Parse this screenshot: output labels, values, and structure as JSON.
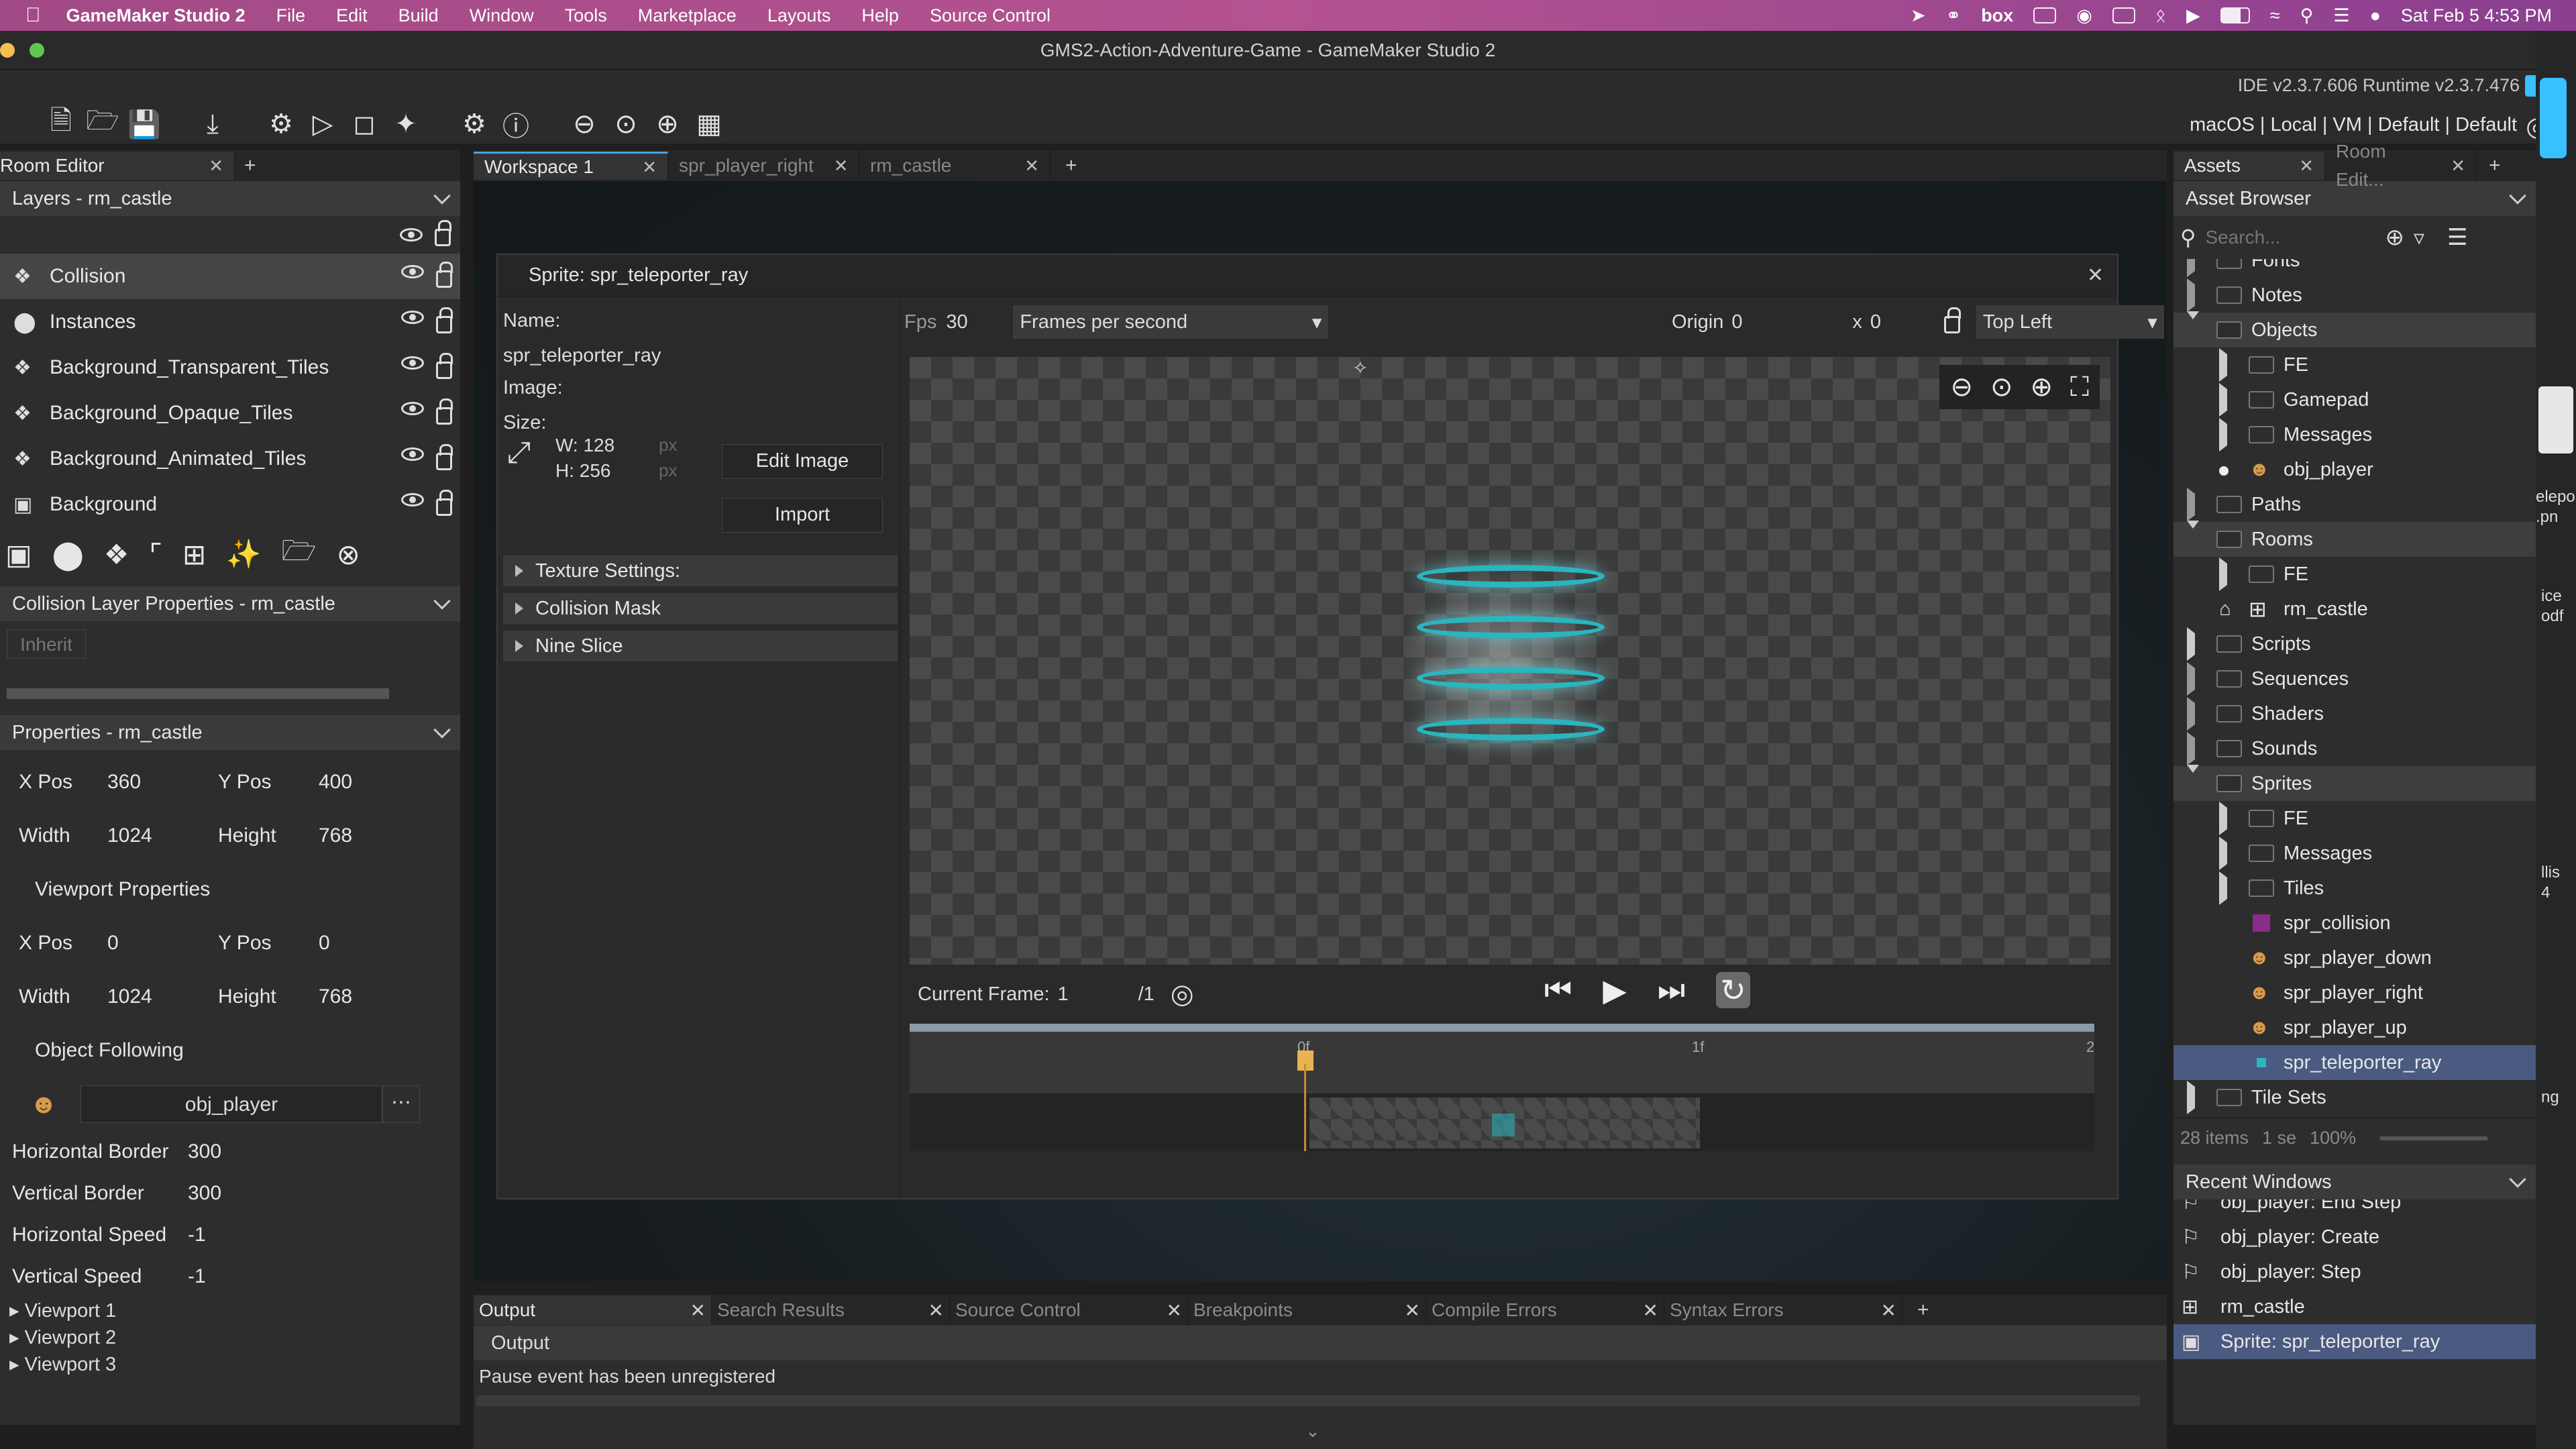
{
  "menubar": {
    "app_name": "GameMaker Studio 2",
    "items": [
      "File",
      "Edit",
      "Build",
      "Window",
      "Tools",
      "Marketplace",
      "Layouts",
      "Help",
      "Source Control"
    ],
    "status_box": "box",
    "clock": "Sat Feb 5  4:53 PM"
  },
  "window": {
    "title": "GMS2-Action-Adventure-Game - GameMaker Studio 2"
  },
  "toolbar": {
    "ide_version": "IDE v2.3.7.606  Runtime v2.3.7.476",
    "target": "macOS | Local | VM | Default | Default"
  },
  "left": {
    "tab_label": "Room Editor",
    "layers_header": "Layers - rm_castle",
    "layers": [
      {
        "name": "Collision",
        "icon": "tiles-icon"
      },
      {
        "name": "Instances",
        "icon": "instances-icon"
      },
      {
        "name": "Background_Transparent_Tiles",
        "icon": "tiles-icon"
      },
      {
        "name": "Background_Opaque_Tiles",
        "icon": "tiles-icon"
      },
      {
        "name": "Background_Animated_Tiles",
        "icon": "tiles-icon"
      },
      {
        "name": "Background",
        "icon": "background-icon"
      }
    ],
    "collision_header": "Collision Layer Properties - rm_castle",
    "inherit_label": "Inherit",
    "properties_header": "Properties - rm_castle",
    "room": {
      "xpos_label": "X Pos",
      "xpos": "360",
      "ypos_label": "Y Pos",
      "ypos": "400",
      "width_label": "Width",
      "width": "1024",
      "height_label": "Height",
      "height": "768"
    },
    "viewport_props_label": "Viewport Properties",
    "viewport": {
      "xpos_label": "X Pos",
      "xpos": "0",
      "ypos_label": "Y Pos",
      "ypos": "0",
      "width_label": "Width",
      "width": "1024",
      "height_label": "Height",
      "height": "768"
    },
    "object_following_label": "Object Following",
    "object_following_value": "obj_player",
    "borders": [
      {
        "label": "Horizontal Border",
        "value": "300"
      },
      {
        "label": "Vertical Border",
        "value": "300"
      },
      {
        "label": "Horizontal Speed",
        "value": "-1"
      },
      {
        "label": "Vertical Speed",
        "value": "-1"
      }
    ],
    "viewports": [
      "Viewport 1",
      "Viewport 2",
      "Viewport 3"
    ]
  },
  "center": {
    "tabs": [
      "Workspace 1",
      "spr_player_right",
      "rm_castle"
    ],
    "sprite": {
      "title": "Sprite: spr_teleporter_ray",
      "name_label": "Name:",
      "name": "spr_teleporter_ray",
      "image_label": "Image:",
      "size_label": "Size:",
      "w": "W: 128",
      "h": "H: 256",
      "px": "px",
      "edit_image": "Edit Image",
      "import": "Import",
      "sections": [
        "Texture Settings:",
        "Collision Mask",
        "Nine Slice"
      ],
      "fps_label": "Fps",
      "fps": "30",
      "fps_mode": "Frames per second",
      "origin_label": "Origin",
      "origin_x": "0",
      "origin_y_prefix": "x",
      "origin_y": "0",
      "origin_mode": "Top Left",
      "current_frame_label": "Current Frame:",
      "current_frame": "1",
      "total_frames": "/1",
      "timeline_marks": [
        "0f",
        "1f",
        "2"
      ]
    },
    "output_tabs": [
      "Output",
      "Search Results",
      "Source Control",
      "Breakpoints",
      "Compile Errors",
      "Syntax Errors"
    ],
    "output_header": "Output",
    "output_text": "Pause event has been unregistered"
  },
  "right": {
    "tabs": [
      "Assets",
      "Room Edit..."
    ],
    "asset_browser": "Asset Browser",
    "search_placeholder": "Search...",
    "tree": [
      {
        "label": "Fonts",
        "depth": 0,
        "kind": "folder",
        "state": "closed-hollow"
      },
      {
        "label": "Notes",
        "depth": 0,
        "kind": "folder",
        "state": "closed-hollow"
      },
      {
        "label": "Objects",
        "depth": 0,
        "kind": "folder",
        "state": "open",
        "sel": true
      },
      {
        "label": "FE",
        "depth": 1,
        "kind": "folder",
        "state": "closed"
      },
      {
        "label": "Gamepad",
        "depth": 1,
        "kind": "folder",
        "state": "closed"
      },
      {
        "label": "Messages",
        "depth": 1,
        "kind": "folder",
        "state": "closed"
      },
      {
        "label": "obj_player",
        "depth": 1,
        "kind": "object",
        "state": "dot"
      },
      {
        "label": "Paths",
        "depth": 0,
        "kind": "folder",
        "state": "closed-hollow"
      },
      {
        "label": "Rooms",
        "depth": 0,
        "kind": "folder",
        "state": "open",
        "sel": true
      },
      {
        "label": "FE",
        "depth": 1,
        "kind": "folder",
        "state": "closed"
      },
      {
        "label": "rm_castle",
        "depth": 1,
        "kind": "room",
        "state": "home"
      },
      {
        "label": "Scripts",
        "depth": 0,
        "kind": "folder",
        "state": "closed"
      },
      {
        "label": "Sequences",
        "depth": 0,
        "kind": "folder",
        "state": "closed-hollow"
      },
      {
        "label": "Shaders",
        "depth": 0,
        "kind": "folder",
        "state": "closed-hollow"
      },
      {
        "label": "Sounds",
        "depth": 0,
        "kind": "folder",
        "state": "closed-hollow"
      },
      {
        "label": "Sprites",
        "depth": 0,
        "kind": "folder",
        "state": "open",
        "sel": true
      },
      {
        "label": "FE",
        "depth": 1,
        "kind": "folder",
        "state": "closed"
      },
      {
        "label": "Messages",
        "depth": 1,
        "kind": "folder",
        "state": "closed"
      },
      {
        "label": "Tiles",
        "depth": 1,
        "kind": "folder",
        "state": "closed"
      },
      {
        "label": "spr_collision",
        "depth": 1,
        "kind": "sprite-purple",
        "state": "none"
      },
      {
        "label": "spr_player_down",
        "depth": 1,
        "kind": "sprite-char",
        "state": "none"
      },
      {
        "label": "spr_player_right",
        "depth": 1,
        "kind": "sprite-char",
        "state": "none"
      },
      {
        "label": "spr_player_up",
        "depth": 1,
        "kind": "sprite-char",
        "state": "none"
      },
      {
        "label": "spr_teleporter_ray",
        "depth": 1,
        "kind": "sprite-ray",
        "state": "none",
        "hl": true
      },
      {
        "label": "Tile Sets",
        "depth": 0,
        "kind": "folder",
        "state": "closed"
      }
    ],
    "items_count": "28 items",
    "selection": "1 se",
    "zoom": "100%",
    "recent_header": "Recent Windows",
    "recent": [
      {
        "label": "obj_player: End Step",
        "icon": "flag-icon"
      },
      {
        "label": "obj_player: Create",
        "icon": "flag-icon"
      },
      {
        "label": "obj_player: Step",
        "icon": "flag-icon"
      },
      {
        "label": "rm_castle",
        "icon": "room-icon"
      },
      {
        "label": "Sprite: spr_teleporter_ray",
        "icon": "sprite-icon",
        "hl": true
      }
    ]
  },
  "edge": {
    "right_texts": [
      "elepo",
      ".pn",
      "ice",
      "odf",
      "llis",
      "4",
      "ng"
    ]
  }
}
